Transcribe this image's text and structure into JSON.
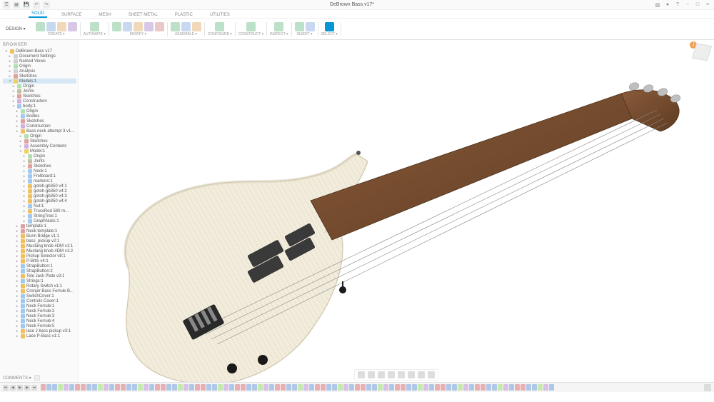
{
  "title": "DeBrown Bass v17*",
  "qat": [
    "file-icon",
    "save-icon",
    "undo-icon",
    "redo-icon"
  ],
  "window_buttons": [
    "−",
    "□",
    "×"
  ],
  "ribbon": {
    "design_label": "DESIGN ▾",
    "tabs": [
      "SOLID",
      "SURFACE",
      "MESH",
      "SHEET METAL",
      "PLASTIC",
      "UTILITIES"
    ],
    "active_tab": "SOLID",
    "groups": [
      {
        "label": "CREATE ▾",
        "icons": 4
      },
      {
        "label": "AUTOMATE ▾",
        "icons": 1
      },
      {
        "label": "MODIFY ▾",
        "icons": 5
      },
      {
        "label": "ASSEMBLE ▾",
        "icons": 3
      },
      {
        "label": "CONFIGURE ▾",
        "icons": 1
      },
      {
        "label": "CONSTRUCT ▾",
        "icons": 1
      },
      {
        "label": "INSPECT ▾",
        "icons": 1
      },
      {
        "label": "INSERT ▾",
        "icons": 2
      },
      {
        "label": "SELECT ▾",
        "icons": 1
      }
    ]
  },
  "browser": {
    "header": "BROWSER",
    "nodes": [
      {
        "d": 0,
        "t": "cmp",
        "l": "DeBrown Bass v17",
        "e": true
      },
      {
        "d": 1,
        "t": "doc",
        "l": "Document Settings"
      },
      {
        "d": 1,
        "t": "doc",
        "l": "Named Views"
      },
      {
        "d": 1,
        "t": "org",
        "l": "Origin"
      },
      {
        "d": 1,
        "t": "doc",
        "l": "Analysis"
      },
      {
        "d": 1,
        "t": "sk",
        "l": "Sketches"
      },
      {
        "d": 1,
        "t": "mdl",
        "l": "Models:1",
        "e": true,
        "sel": true
      },
      {
        "d": 2,
        "t": "org",
        "l": "Origin"
      },
      {
        "d": 2,
        "t": "jnt",
        "l": "Joints"
      },
      {
        "d": 2,
        "t": "sk",
        "l": "Sketches"
      },
      {
        "d": 2,
        "t": "cn",
        "l": "Construction"
      },
      {
        "d": 2,
        "t": "bd",
        "l": "body:1",
        "e": true
      },
      {
        "d": 3,
        "t": "org",
        "l": "Origin"
      },
      {
        "d": 3,
        "t": "bd",
        "l": "Bodies"
      },
      {
        "d": 3,
        "t": "sk",
        "l": "Sketches"
      },
      {
        "d": 3,
        "t": "cn",
        "l": "Construction"
      },
      {
        "d": 3,
        "t": "cmp",
        "l": "Bass neck attempt 3 v1..."
      },
      {
        "d": 4,
        "t": "org",
        "l": "Origin"
      },
      {
        "d": 4,
        "t": "sk",
        "l": "Sketches"
      },
      {
        "d": 4,
        "t": "cn",
        "l": "Assembly Contexts"
      },
      {
        "d": 4,
        "t": "mdl",
        "l": "Model:1",
        "e": true
      },
      {
        "d": 5,
        "t": "org",
        "l": "Origin"
      },
      {
        "d": 5,
        "t": "jnt",
        "l": "Joints"
      },
      {
        "d": 5,
        "t": "sk",
        "l": "Sketches"
      },
      {
        "d": 5,
        "t": "bd",
        "l": "Neck:1"
      },
      {
        "d": 5,
        "t": "bd",
        "l": "Fretboard:1"
      },
      {
        "d": 5,
        "t": "bd",
        "l": "markers:1"
      },
      {
        "d": 5,
        "t": "cmp",
        "l": "gotoh-gb350 v4:1"
      },
      {
        "d": 5,
        "t": "cmp",
        "l": "gotoh-gb350 v4:2"
      },
      {
        "d": 5,
        "t": "cmp",
        "l": "gotoh-gb350 v4:3"
      },
      {
        "d": 5,
        "t": "cmp",
        "l": "gotoh-gb350 v4:4"
      },
      {
        "d": 5,
        "t": "bd",
        "l": "Nut:1"
      },
      {
        "d": 5,
        "t": "cmp",
        "l": "TrussRod 580 m..."
      },
      {
        "d": 5,
        "t": "bd",
        "l": "StringTree:1"
      },
      {
        "d": 5,
        "t": "bd",
        "l": "GraphNubs:1"
      },
      {
        "d": 3,
        "t": "sk",
        "l": "template:1"
      },
      {
        "d": 3,
        "t": "sk",
        "l": "Neck template:1"
      },
      {
        "d": 3,
        "t": "cmp",
        "l": "Bunn Bridge v1:1"
      },
      {
        "d": 3,
        "t": "cmp",
        "l": "bass_pickup v2:1"
      },
      {
        "d": 3,
        "t": "cmp",
        "l": "Mustang knob #DM v1:1"
      },
      {
        "d": 3,
        "t": "cmp",
        "l": "Mustang knob #DM v1:2"
      },
      {
        "d": 3,
        "t": "cmp",
        "l": "Pickup Selector v8:1"
      },
      {
        "d": 3,
        "t": "cmp",
        "l": "P-Bitts v4:1"
      },
      {
        "d": 3,
        "t": "bd",
        "l": "StrapButton:1"
      },
      {
        "d": 3,
        "t": "bd",
        "l": "StrapButton:2"
      },
      {
        "d": 3,
        "t": "cmp",
        "l": "Tele Jack Plate v3:1"
      },
      {
        "d": 3,
        "t": "bd",
        "l": "Strings:1"
      },
      {
        "d": 3,
        "t": "cmp",
        "l": "Rotary Switch v1:1"
      },
      {
        "d": 3,
        "t": "cmp",
        "l": "Cronjer Bass Ferrule B..."
      },
      {
        "d": 3,
        "t": "bd",
        "l": "SwitchCover:1"
      },
      {
        "d": 3,
        "t": "bd",
        "l": "Controls Cover:1"
      },
      {
        "d": 3,
        "t": "bd",
        "l": "Neck Ferrule:1"
      },
      {
        "d": 3,
        "t": "bd",
        "l": "Neck Ferrule:2"
      },
      {
        "d": 3,
        "t": "bd",
        "l": "Neck Ferrule:3"
      },
      {
        "d": 3,
        "t": "bd",
        "l": "Neck Ferrule:4"
      },
      {
        "d": 3,
        "t": "bd",
        "l": "Neck Ferrule:5"
      },
      {
        "d": 3,
        "t": "cmp",
        "l": "lace J bass pickup v3:1"
      },
      {
        "d": 3,
        "t": "cmp",
        "l": "Lace P-Bass v1:1"
      }
    ]
  },
  "navbar_icons": 8,
  "comments_label": "COMMENTS ▾",
  "timeline_items": 90,
  "person_initial": "J"
}
